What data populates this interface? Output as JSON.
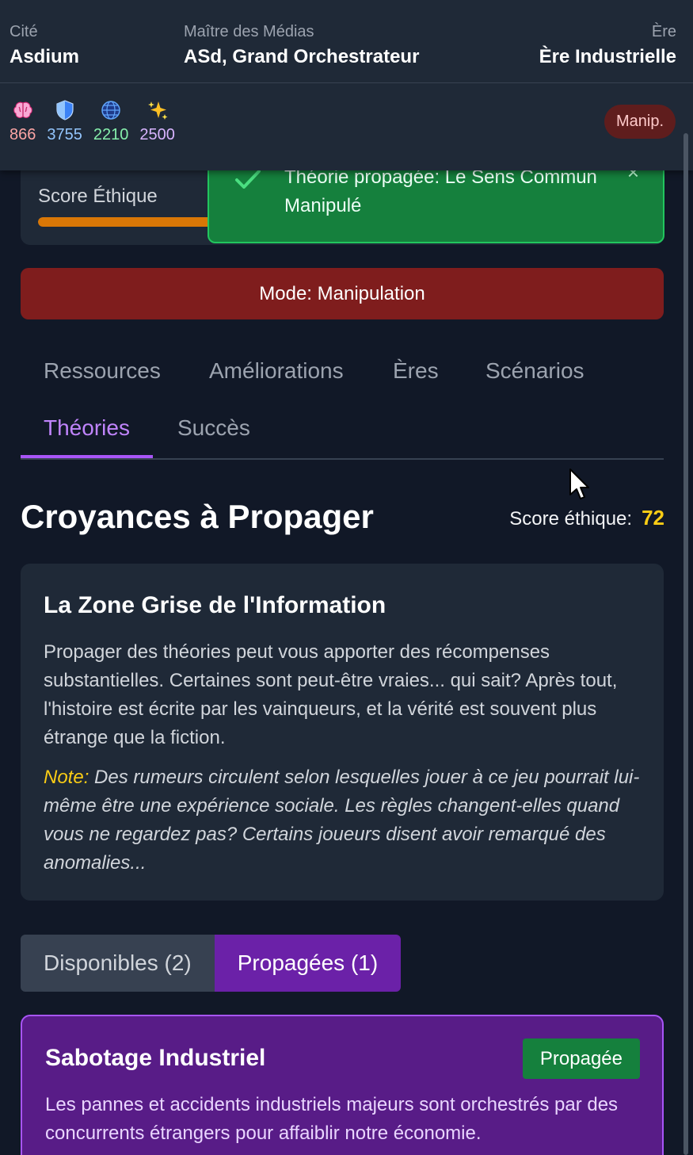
{
  "header": {
    "city_label": "Cité",
    "city_value": "Asdium",
    "master_label": "Maître des Médias",
    "master_value": "ASd, Grand Orchestrateur",
    "era_label": "Ère",
    "era_value": "Ère Industrielle"
  },
  "stats": [
    {
      "icon": "brain-icon",
      "value": "866",
      "color": "#fca5a5"
    },
    {
      "icon": "shield-icon",
      "value": "3755",
      "color": "#93c5fd"
    },
    {
      "icon": "globe-icon",
      "value": "2210",
      "color": "#86efac"
    },
    {
      "icon": "sparkles-icon",
      "value": "2500",
      "color": "#d8b4fe"
    }
  ],
  "mode_badge": "Manip.",
  "ethics": {
    "label": "Score Éthique",
    "fill_percent": 72
  },
  "toast": {
    "message": "Théorie propagée: Le Sens Commun Manipulé",
    "close": "×"
  },
  "mode_button": "Mode: Manipulation",
  "tabs": {
    "ressources": "Ressources",
    "ameliorations": "Améliorations",
    "eres": "Ères",
    "scenarios": "Scénarios",
    "theories": "Théories",
    "succes": "Succès"
  },
  "section": {
    "title": "Croyances à Propager",
    "score_label": "Score éthique:",
    "score_value": "72"
  },
  "info": {
    "title": "La Zone Grise de l'Information",
    "paragraph": "Propager des théories peut vous apporter des récompenses substantielles. Certaines sont peut-être vraies... qui sait? Après tout, l'histoire est écrite par les vainqueurs, et la vérité est souvent plus étrange que la fiction.",
    "note_label": "Note:",
    "note_text": "Des rumeurs circulent selon lesquelles jouer à ce jeu pourrait lui-même être une expérience sociale. Les règles changent-elles quand vous ne regardez pas? Certains joueurs disent avoir remarqué des anomalies..."
  },
  "subtabs": {
    "available": "Disponibles (2)",
    "propagated": "Propagées (1)"
  },
  "theory": {
    "title": "Sabotage Industriel",
    "badge": "Propagée",
    "description": "Les pannes et accidents industriels majeurs sont orchestrés par des concurrents étrangers pour affaiblir notre économie."
  },
  "colors": {
    "accent": "#a855f7",
    "success": "#15803d",
    "danger": "#7f1d1d",
    "warning": "#facc15"
  }
}
